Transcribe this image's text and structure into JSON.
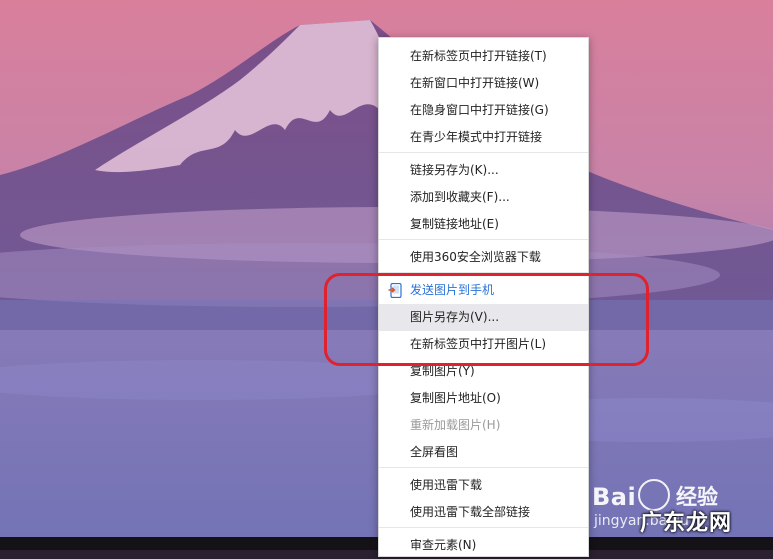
{
  "menu": {
    "items": [
      {
        "label": "在新标签页中打开链接(T)"
      },
      {
        "label": "在新窗口中打开链接(W)"
      },
      {
        "label": "在隐身窗口中打开链接(G)"
      },
      {
        "label": "在青少年模式中打开链接"
      },
      {
        "label": "链接另存为(K)..."
      },
      {
        "label": "添加到收藏夹(F)..."
      },
      {
        "label": "复制链接地址(E)"
      },
      {
        "label": "使用360安全浏览器下载"
      },
      {
        "label": "发送图片到手机",
        "icon": "send-to-phone-icon",
        "color": "#2a72d6"
      },
      {
        "label": "图片另存为(V)..."
      },
      {
        "label": "在新标签页中打开图片(L)"
      },
      {
        "label": "复制图片(Y)"
      },
      {
        "label": "复制图片地址(O)"
      },
      {
        "label": "重新加载图片(H)",
        "state": "disabled"
      },
      {
        "label": "全屏看图"
      },
      {
        "label": "使用迅雷下载"
      },
      {
        "label": "使用迅雷下载全部链接"
      },
      {
        "label": "审查元素(N)"
      }
    ]
  },
  "highlight_color": "#e0212e",
  "watermark": {
    "baidu": "Bai",
    "baidu_suffix": "经验",
    "site": "jingyan.baidu",
    "overlay": "广东龙网"
  }
}
